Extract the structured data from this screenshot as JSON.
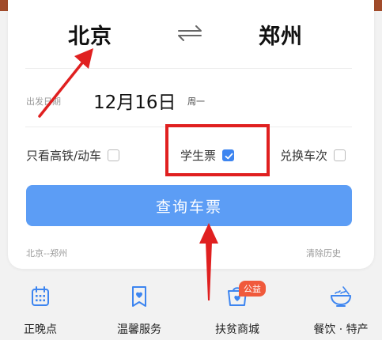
{
  "route": {
    "from": "北京",
    "to": "郑州"
  },
  "date": {
    "label": "出发日期",
    "value": "12月16日",
    "weekday": "周一"
  },
  "options": [
    {
      "label": "只看高铁/动车",
      "checked": false
    },
    {
      "label": "学生票",
      "checked": true
    },
    {
      "label": "兑换车次",
      "checked": false
    }
  ],
  "search_button": "查询车票",
  "history": {
    "item": "北京--郑州",
    "clear": "清除历史"
  },
  "nav": [
    {
      "label": "正晚点",
      "icon": "calendar-icon"
    },
    {
      "label": "温馨服务",
      "icon": "service-icon"
    },
    {
      "label": "扶贫商城",
      "icon": "mall-icon",
      "badge": "公益"
    },
    {
      "label": "餐饮 · 特产",
      "icon": "noodle-bowl-icon"
    }
  ],
  "colors": {
    "accent": "#3d85f0",
    "button": "#5c9df5",
    "annotation": "#e02020"
  }
}
